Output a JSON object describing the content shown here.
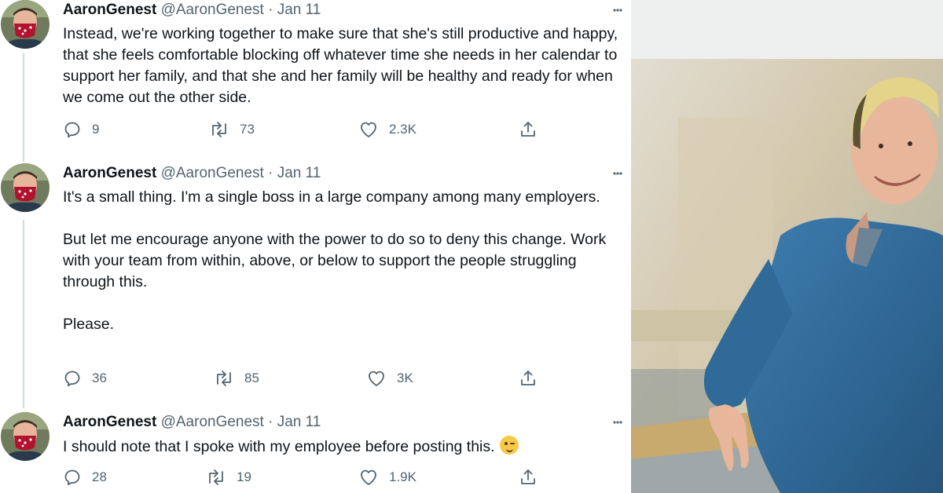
{
  "tweets": [
    {
      "name": "AaronGenest",
      "handle": "@AaronGenest",
      "sep": "·",
      "date": "Jan 11",
      "paragraphs": [
        "Instead, we're working together to make sure that she's still productive and happy, that she feels comfortable blocking off whatever time she needs in her calendar to support her family, and that she and her family will be healthy and ready for when we come out the other side."
      ],
      "replies": "9",
      "retweets": "73",
      "likes": "2.3K"
    },
    {
      "name": "AaronGenest",
      "handle": "@AaronGenest",
      "sep": "·",
      "date": "Jan 11",
      "paragraphs": [
        "It's a small thing. I'm a single boss in a large company among many employers.",
        "But let me encourage anyone with the power to do so to deny this change. Work with your team from within, above, or below to support the people struggling through this.",
        "Please."
      ],
      "replies": "36",
      "retweets": "85",
      "likes": "3K"
    },
    {
      "name": "AaronGenest",
      "handle": "@AaronGenest",
      "sep": "·",
      "date": "Jan 11",
      "paragraphs": [
        "I should note that I spoke with my employee before posting this."
      ],
      "replies": "28",
      "retweets": "19",
      "likes": "1.9K"
    }
  ],
  "icons": {
    "reply": "reply-icon",
    "retweet": "retweet-icon",
    "like": "heart-icon",
    "share": "share-icon",
    "more": "more-icon",
    "emoji": "winking-face-emoji"
  },
  "colors": {
    "text": "#0f1419",
    "secondary": "#536471",
    "thread_line": "#cfd9de",
    "photo_shirt": "#2f6a99"
  }
}
